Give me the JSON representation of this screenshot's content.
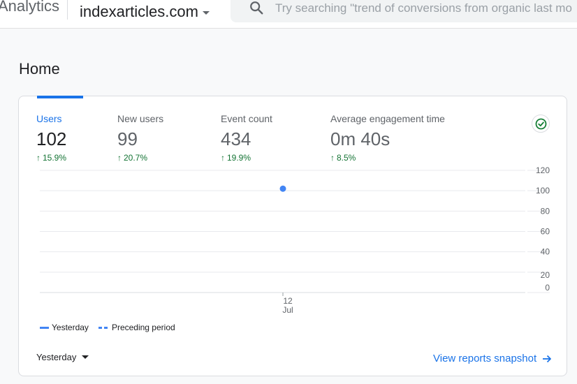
{
  "header": {
    "app_name": "Analytics",
    "property_name": "indexarticles.com",
    "search": {
      "placeholder": "Try searching \"trend of conversions from organic last mo"
    }
  },
  "page": {
    "title": "Home"
  },
  "metrics": [
    {
      "label": "Users",
      "value": "102",
      "change": "15.9%",
      "direction": "up",
      "active": true
    },
    {
      "label": "New users",
      "value": "99",
      "change": "20.7%",
      "direction": "up",
      "active": false
    },
    {
      "label": "Event count",
      "value": "434",
      "change": "19.9%",
      "direction": "up",
      "active": false
    },
    {
      "label": "Average engagement time",
      "value": "0m 40s",
      "change": "8.5%",
      "direction": "up",
      "active": false
    }
  ],
  "icons": {
    "status": "check-circle-icon",
    "search": "search-icon",
    "link_arrow": "arrow-right-icon"
  },
  "colors": {
    "accent": "#1a73e8",
    "series": "#4285f4",
    "positive": "#137333",
    "check": "#188038"
  },
  "chart_data": {
    "type": "line",
    "x_tick_day": "12",
    "x_tick_month": "Jul",
    "y_ticks": [
      "120",
      "100",
      "80",
      "60",
      "40",
      "20",
      "0"
    ],
    "ylim": [
      0,
      120
    ],
    "series": [
      {
        "name": "Yesterday",
        "style": "solid",
        "points": [
          {
            "x": "12 Jul",
            "y": 102
          }
        ]
      },
      {
        "name": "Preceding period",
        "style": "dashed",
        "points": []
      }
    ],
    "grid": true,
    "legend_position": "bottom-left"
  },
  "legend": {
    "series_current": "Yesterday",
    "series_previous": "Preceding period"
  },
  "footer": {
    "date_range": "Yesterday",
    "snapshot_link": "View reports snapshot"
  }
}
